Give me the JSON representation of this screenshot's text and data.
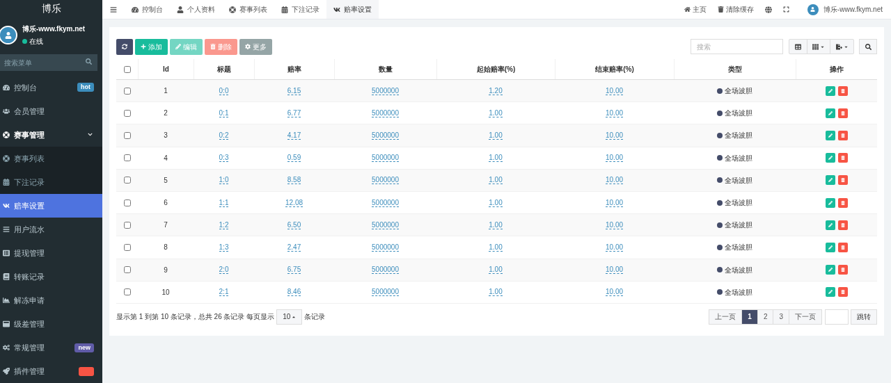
{
  "sidebar": {
    "logo": "博乐",
    "user": {
      "name": "博乐-www.fkym.net",
      "status": "在线",
      "online": true
    },
    "search": {
      "placeholder": "搜索菜单"
    },
    "items": [
      {
        "label": "控制台",
        "badge": {
          "text": "hot",
          "color": "#3c8dbc"
        },
        "selected": false
      },
      {
        "label": "会员管理",
        "selected": false
      },
      {
        "label": "赛事管理",
        "expanded": true,
        "selected": false,
        "children": [
          {
            "label": "赛事列表",
            "selected": false
          },
          {
            "label": "下注记录",
            "selected": false
          }
        ]
      },
      {
        "label": "赔率设置",
        "selected": true
      },
      {
        "label": "用户流水",
        "selected": false
      },
      {
        "label": "提现管理",
        "selected": false
      },
      {
        "label": "转账记录",
        "selected": false
      },
      {
        "label": "解冻申请",
        "selected": false
      },
      {
        "label": "级差管理",
        "selected": false
      },
      {
        "label": "常规管理",
        "badge": {
          "text": "new",
          "color": "#605ca8"
        },
        "selected": false
      },
      {
        "label": "插件管理",
        "badge": {
          "color": "#f75444"
        },
        "selected": false
      }
    ]
  },
  "topbar": {
    "tabs": [
      {
        "label": "控制台",
        "selected": false
      },
      {
        "label": "个人资料",
        "selected": false
      },
      {
        "label": "赛事列表",
        "selected": false
      },
      {
        "label": "下注记录",
        "selected": false
      },
      {
        "label": "赔率设置",
        "selected": true
      }
    ],
    "right": [
      "主页",
      "清除缓存"
    ],
    "user": "博乐-www.fkym.net"
  },
  "toolbar": {
    "buttons": [
      {
        "kind": "refresh",
        "disabled": false
      },
      {
        "kind": "add",
        "label": "添加",
        "disabled": false
      },
      {
        "kind": "edit",
        "label": "编辑",
        "disabled": true
      },
      {
        "kind": "delete",
        "label": "删除",
        "disabled": true
      },
      {
        "kind": "more",
        "label": "更多",
        "disabled": false
      }
    ],
    "search": {
      "placeholder": "搜索"
    }
  },
  "table": {
    "all_checked": false,
    "columns": [
      "Id",
      "标题",
      "赔率",
      "数量",
      "起始赔率(%)",
      "结束赔率(%)",
      "类型",
      "操作"
    ],
    "rows": [
      {
        "checked": false,
        "cells": [
          "1",
          "0:0",
          "6.15",
          "5000000",
          "1.20",
          "10.00",
          "全场波胆"
        ]
      },
      {
        "checked": false,
        "cells": [
          "2",
          "0:1",
          "6.77",
          "5000000",
          "1.00",
          "10.00",
          "全场波胆"
        ]
      },
      {
        "checked": false,
        "cells": [
          "3",
          "0:2",
          "4.17",
          "5000000",
          "1.00",
          "10.00",
          "全场波胆"
        ]
      },
      {
        "checked": false,
        "cells": [
          "4",
          "0:3",
          "0.59",
          "5000000",
          "1.00",
          "10.00",
          "全场波胆"
        ]
      },
      {
        "checked": false,
        "cells": [
          "5",
          "1:0",
          "8.58",
          "5000000",
          "1.00",
          "10.00",
          "全场波胆"
        ]
      },
      {
        "checked": false,
        "cells": [
          "6",
          "1:1",
          "12.08",
          "5000000",
          "1.00",
          "10.00",
          "全场波胆"
        ]
      },
      {
        "checked": false,
        "cells": [
          "7",
          "1:2",
          "6.50",
          "5000000",
          "1.00",
          "10.00",
          "全场波胆"
        ]
      },
      {
        "checked": false,
        "cells": [
          "8",
          "1:3",
          "2.47",
          "5000000",
          "1.00",
          "10.00",
          "全场波胆"
        ]
      },
      {
        "checked": false,
        "cells": [
          "9",
          "2:0",
          "6.75",
          "5000000",
          "1.00",
          "10.00",
          "全场波胆"
        ]
      },
      {
        "checked": false,
        "cells": [
          "10",
          "2:1",
          "8.46",
          "5000000",
          "1.00",
          "10.00",
          "全场波胆"
        ]
      }
    ]
  },
  "footer": {
    "summary": "显示第 1 到第 10 条记录，总共 26 条记录 每页显示",
    "page_size": "10",
    "suffix": "条记录",
    "pages": [
      {
        "label": "上一页",
        "selected": false
      },
      {
        "label": "1",
        "selected": true
      },
      {
        "label": "2",
        "selected": false
      },
      {
        "label": "3",
        "selected": false
      },
      {
        "label": "下一页",
        "selected": false
      }
    ],
    "jump": "跳转"
  }
}
